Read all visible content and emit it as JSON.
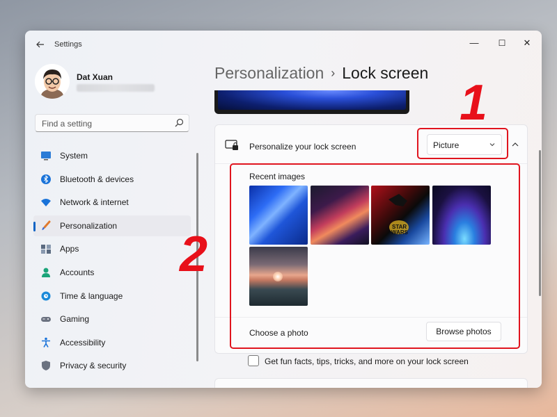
{
  "window": {
    "app_title": "Settings",
    "controls": {
      "minimize": "—",
      "maximize": "☐",
      "close": "✕"
    }
  },
  "profile": {
    "name": "Dat Xuan"
  },
  "search": {
    "placeholder": "Find a setting"
  },
  "sidebar": {
    "items": [
      {
        "label": "System",
        "icon": "system-icon",
        "color": "#2b7bd6"
      },
      {
        "label": "Bluetooth & devices",
        "icon": "bluetooth-icon",
        "color": "#1a73d9"
      },
      {
        "label": "Network & internet",
        "icon": "wifi-icon",
        "color": "#1a73d9"
      },
      {
        "label": "Personalization",
        "icon": "brush-icon",
        "color": "#e07a2e",
        "active": true
      },
      {
        "label": "Apps",
        "icon": "apps-icon",
        "color": "#5a6a80"
      },
      {
        "label": "Accounts",
        "icon": "accounts-icon",
        "color": "#1aa47a"
      },
      {
        "label": "Time & language",
        "icon": "globe-clock-icon",
        "color": "#1a8ad9"
      },
      {
        "label": "Gaming",
        "icon": "gamepad-icon",
        "color": "#6b7280"
      },
      {
        "label": "Accessibility",
        "icon": "accessibility-icon",
        "color": "#1a73d9"
      },
      {
        "label": "Privacy & security",
        "icon": "shield-icon",
        "color": "#6b7280"
      }
    ]
  },
  "breadcrumb": {
    "parent": "Personalization",
    "separator": "›",
    "current": "Lock screen"
  },
  "lock_card": {
    "title": "Personalize your lock screen",
    "dropdown_value": "Picture",
    "recent_images_label": "Recent images",
    "choose_photo_label": "Choose a photo",
    "browse_button": "Browse photos"
  },
  "fun_facts": {
    "label": "Get fun facts, tips, tricks, and more on your lock screen",
    "checked": false
  },
  "annotations": {
    "one": "1",
    "two": "2",
    "color": "#e0141e"
  }
}
